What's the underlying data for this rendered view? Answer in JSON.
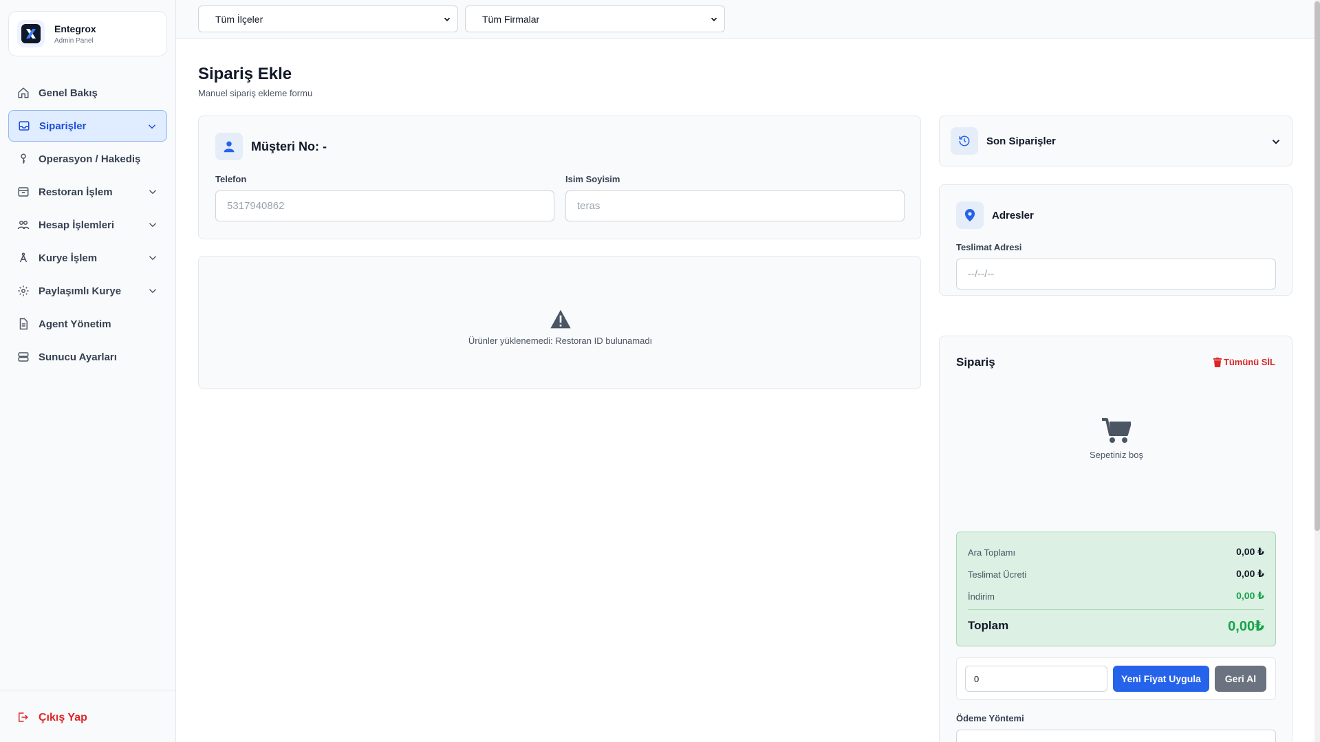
{
  "brand": {
    "name": "Entegrox",
    "subtitle": "Admin Panel"
  },
  "sidebar": {
    "items": [
      {
        "label": "Genel Bakış"
      },
      {
        "label": "Siparişler"
      },
      {
        "label": "Operasyon / Hakediş"
      },
      {
        "label": "Restoran İşlem"
      },
      {
        "label": "Hesap İşlemleri"
      },
      {
        "label": "Kurye İşlem"
      },
      {
        "label": "Paylaşımlı Kurye"
      },
      {
        "label": "Agent Yönetim"
      },
      {
        "label": "Sunucu Ayarları"
      }
    ],
    "logout": "Çıkış Yap"
  },
  "filters": {
    "district": "Tüm İlçeler",
    "company": "Tüm Firmalar"
  },
  "page": {
    "title": "Sipariş Ekle",
    "subtitle": "Manuel sipariş ekleme formu"
  },
  "customer": {
    "title": "Müşteri No: -",
    "phone_label": "Telefon",
    "phone_placeholder": "5317940862",
    "name_label": "Isim Soyisim",
    "name_placeholder": "teras"
  },
  "products": {
    "error": "Ürünler yüklenemedi: Restoran ID bulunamadı"
  },
  "recent": {
    "title": "Son Siparişler"
  },
  "addresses": {
    "title": "Adresler",
    "delivery_label": "Teslimat Adresi",
    "delivery_placeholder": "--/--/--"
  },
  "order": {
    "title": "Sipariş",
    "delete_all": "Tümünü SİL",
    "empty": "Sepetiniz boş",
    "subtotal_label": "Ara Toplamı",
    "subtotal": "0,00 ₺",
    "delivery_fee_label": "Teslimat Ücreti",
    "delivery_fee": "0,00 ₺",
    "discount_label": "İndirim",
    "discount": "0,00 ₺",
    "total_label": "Toplam",
    "total": "0,00₺",
    "price_value": "0",
    "apply_button": "Yeni Fiyat Uygula",
    "revert_button": "Geri Al",
    "payment_label": "Ödeme Yöntemi"
  },
  "colors": {
    "accent": "#2563eb",
    "danger": "#dc2626",
    "success": "#16a34a",
    "summary_bg": "#dcf0e3"
  }
}
